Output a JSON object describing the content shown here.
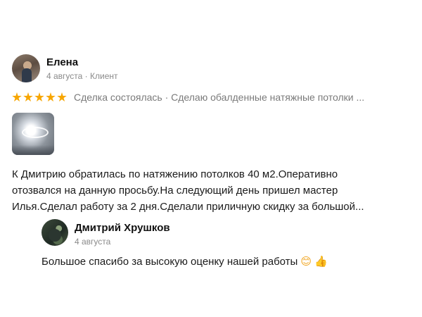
{
  "review": {
    "author": "Елена",
    "date": "4 августа",
    "role": "Клиент",
    "separator": " · ",
    "rating": 5,
    "rating_text": "Сделка состоялась · Сделаю обалденные натяжные потолки ...",
    "text_lines": [
      "К Дмитрию обратилась по натяжению потолков 40 м2.Оперативно",
      "отозвался на данную просьбу.На следующий день пришел мастер",
      "Илья.Сделал работу за 2 дня.Сделали приличную скидку за большой..."
    ]
  },
  "reply": {
    "author": "Дмитрий Хрушков",
    "date": "4 августа",
    "text": "Большое спасибо за высокую оценку нашей работы",
    "emoji_1": "😊",
    "emoji_2": "👍"
  },
  "colors": {
    "star": "#f7a600",
    "meta": "#8a8a8a"
  },
  "icons": [
    "star-icon",
    "smile-emoji-icon",
    "thumbs-up-emoji-icon"
  ]
}
